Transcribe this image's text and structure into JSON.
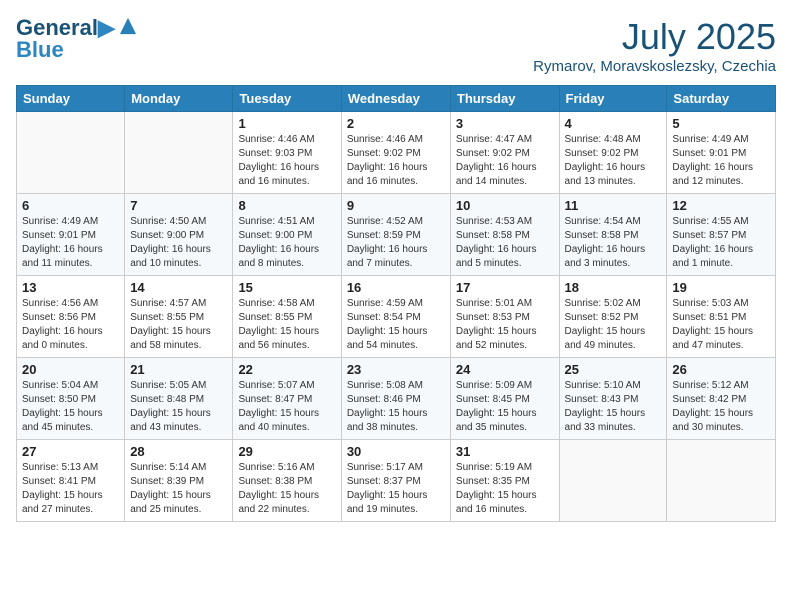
{
  "header": {
    "logo_line1": "General",
    "logo_line2": "Blue",
    "month": "July 2025",
    "location": "Rymarov, Moravskoslezsky, Czechia"
  },
  "weekdays": [
    "Sunday",
    "Monday",
    "Tuesday",
    "Wednesday",
    "Thursday",
    "Friday",
    "Saturday"
  ],
  "weeks": [
    [
      {
        "day": "",
        "content": ""
      },
      {
        "day": "",
        "content": ""
      },
      {
        "day": "1",
        "content": "Sunrise: 4:46 AM\nSunset: 9:03 PM\nDaylight: 16 hours\nand 16 minutes."
      },
      {
        "day": "2",
        "content": "Sunrise: 4:46 AM\nSunset: 9:02 PM\nDaylight: 16 hours\nand 16 minutes."
      },
      {
        "day": "3",
        "content": "Sunrise: 4:47 AM\nSunset: 9:02 PM\nDaylight: 16 hours\nand 14 minutes."
      },
      {
        "day": "4",
        "content": "Sunrise: 4:48 AM\nSunset: 9:02 PM\nDaylight: 16 hours\nand 13 minutes."
      },
      {
        "day": "5",
        "content": "Sunrise: 4:49 AM\nSunset: 9:01 PM\nDaylight: 16 hours\nand 12 minutes."
      }
    ],
    [
      {
        "day": "6",
        "content": "Sunrise: 4:49 AM\nSunset: 9:01 PM\nDaylight: 16 hours\nand 11 minutes."
      },
      {
        "day": "7",
        "content": "Sunrise: 4:50 AM\nSunset: 9:00 PM\nDaylight: 16 hours\nand 10 minutes."
      },
      {
        "day": "8",
        "content": "Sunrise: 4:51 AM\nSunset: 9:00 PM\nDaylight: 16 hours\nand 8 minutes."
      },
      {
        "day": "9",
        "content": "Sunrise: 4:52 AM\nSunset: 8:59 PM\nDaylight: 16 hours\nand 7 minutes."
      },
      {
        "day": "10",
        "content": "Sunrise: 4:53 AM\nSunset: 8:58 PM\nDaylight: 16 hours\nand 5 minutes."
      },
      {
        "day": "11",
        "content": "Sunrise: 4:54 AM\nSunset: 8:58 PM\nDaylight: 16 hours\nand 3 minutes."
      },
      {
        "day": "12",
        "content": "Sunrise: 4:55 AM\nSunset: 8:57 PM\nDaylight: 16 hours\nand 1 minute."
      }
    ],
    [
      {
        "day": "13",
        "content": "Sunrise: 4:56 AM\nSunset: 8:56 PM\nDaylight: 16 hours\nand 0 minutes."
      },
      {
        "day": "14",
        "content": "Sunrise: 4:57 AM\nSunset: 8:55 PM\nDaylight: 15 hours\nand 58 minutes."
      },
      {
        "day": "15",
        "content": "Sunrise: 4:58 AM\nSunset: 8:55 PM\nDaylight: 15 hours\nand 56 minutes."
      },
      {
        "day": "16",
        "content": "Sunrise: 4:59 AM\nSunset: 8:54 PM\nDaylight: 15 hours\nand 54 minutes."
      },
      {
        "day": "17",
        "content": "Sunrise: 5:01 AM\nSunset: 8:53 PM\nDaylight: 15 hours\nand 52 minutes."
      },
      {
        "day": "18",
        "content": "Sunrise: 5:02 AM\nSunset: 8:52 PM\nDaylight: 15 hours\nand 49 minutes."
      },
      {
        "day": "19",
        "content": "Sunrise: 5:03 AM\nSunset: 8:51 PM\nDaylight: 15 hours\nand 47 minutes."
      }
    ],
    [
      {
        "day": "20",
        "content": "Sunrise: 5:04 AM\nSunset: 8:50 PM\nDaylight: 15 hours\nand 45 minutes."
      },
      {
        "day": "21",
        "content": "Sunrise: 5:05 AM\nSunset: 8:48 PM\nDaylight: 15 hours\nand 43 minutes."
      },
      {
        "day": "22",
        "content": "Sunrise: 5:07 AM\nSunset: 8:47 PM\nDaylight: 15 hours\nand 40 minutes."
      },
      {
        "day": "23",
        "content": "Sunrise: 5:08 AM\nSunset: 8:46 PM\nDaylight: 15 hours\nand 38 minutes."
      },
      {
        "day": "24",
        "content": "Sunrise: 5:09 AM\nSunset: 8:45 PM\nDaylight: 15 hours\nand 35 minutes."
      },
      {
        "day": "25",
        "content": "Sunrise: 5:10 AM\nSunset: 8:43 PM\nDaylight: 15 hours\nand 33 minutes."
      },
      {
        "day": "26",
        "content": "Sunrise: 5:12 AM\nSunset: 8:42 PM\nDaylight: 15 hours\nand 30 minutes."
      }
    ],
    [
      {
        "day": "27",
        "content": "Sunrise: 5:13 AM\nSunset: 8:41 PM\nDaylight: 15 hours\nand 27 minutes."
      },
      {
        "day": "28",
        "content": "Sunrise: 5:14 AM\nSunset: 8:39 PM\nDaylight: 15 hours\nand 25 minutes."
      },
      {
        "day": "29",
        "content": "Sunrise: 5:16 AM\nSunset: 8:38 PM\nDaylight: 15 hours\nand 22 minutes."
      },
      {
        "day": "30",
        "content": "Sunrise: 5:17 AM\nSunset: 8:37 PM\nDaylight: 15 hours\nand 19 minutes."
      },
      {
        "day": "31",
        "content": "Sunrise: 5:19 AM\nSunset: 8:35 PM\nDaylight: 15 hours\nand 16 minutes."
      },
      {
        "day": "",
        "content": ""
      },
      {
        "day": "",
        "content": ""
      }
    ]
  ]
}
